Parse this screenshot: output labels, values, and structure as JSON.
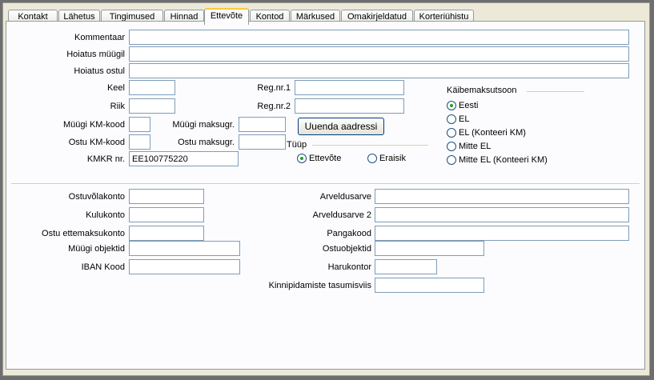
{
  "tabs": [
    {
      "label": "Kontakt"
    },
    {
      "label": "Lähetus"
    },
    {
      "label": "Tingimused"
    },
    {
      "label": "Hinnad"
    },
    {
      "label": "Ettevõte"
    },
    {
      "label": "Kontod"
    },
    {
      "label": "Märkused"
    },
    {
      "label": "Omakirjeldatud"
    },
    {
      "label": "Korteriühistu"
    }
  ],
  "form": {
    "kommentaar": {
      "label": "Kommentaar",
      "value": ""
    },
    "hoiatus_myygil": {
      "label": "Hoiatus müügil",
      "value": ""
    },
    "hoiatus_ostul": {
      "label": "Hoiatus ostul",
      "value": ""
    },
    "keel": {
      "label": "Keel",
      "value": ""
    },
    "riik": {
      "label": "Riik",
      "value": ""
    },
    "myygi_km_kood": {
      "label": "Müügi KM-kood",
      "value": ""
    },
    "ostu_km_kood": {
      "label": "Ostu KM-kood",
      "value": ""
    },
    "kmkr_nr": {
      "label": "KMKR nr.",
      "value": "EE100775220"
    },
    "reg_nr1": {
      "label": "Reg.nr.1",
      "value": ""
    },
    "reg_nr2": {
      "label": "Reg.nr.2",
      "value": ""
    },
    "myygi_maksugr": {
      "label": "Müügi maksugr.",
      "value": ""
    },
    "ostu_maksugr": {
      "label": "Ostu maksugr.",
      "value": ""
    },
    "uuenda_button": "Uuenda aadressi",
    "tyyp": {
      "label": "Tüüp",
      "options": [
        {
          "label": "Ettevõte",
          "checked": true
        },
        {
          "label": "Eraisik",
          "checked": false
        }
      ]
    },
    "kaibemaksutsoon": {
      "label": "Käibemaksutsoon",
      "options": [
        {
          "label": "Eesti",
          "checked": true
        },
        {
          "label": "EL",
          "checked": false
        },
        {
          "label": "EL (Konteeri KM)",
          "checked": false
        },
        {
          "label": "Mitte EL",
          "checked": false
        },
        {
          "label": "Mitte EL (Konteeri KM)",
          "checked": false
        }
      ]
    }
  },
  "accounts": {
    "ostuvolakonto": {
      "label": "Ostuvõlakonto",
      "value": ""
    },
    "kulukonto": {
      "label": "Kulukonto",
      "value": ""
    },
    "ostu_ettemaksukonto": {
      "label": "Ostu ettemaksukonto",
      "value": ""
    },
    "myygi_objektid": {
      "label": "Müügi objektid",
      "value": ""
    },
    "iban_kood": {
      "label": "IBAN Kood",
      "value": ""
    },
    "arveldusarve": {
      "label": "Arveldusarve",
      "value": ""
    },
    "arveldusarve2": {
      "label": "Arveldusarve 2",
      "value": ""
    },
    "pangakood": {
      "label": "Pangakood",
      "value": ""
    },
    "ostuobjektid": {
      "label": "Ostuobjektid",
      "value": ""
    },
    "harukontor": {
      "label": "Harukontor",
      "value": ""
    },
    "kinnipidamiste": {
      "label": "Kinnipidamiste tasumisviis",
      "value": ""
    }
  }
}
